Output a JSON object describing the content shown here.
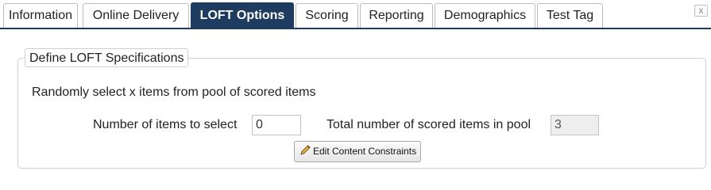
{
  "tabs": [
    {
      "label": "Information",
      "active": false
    },
    {
      "label": "Online Delivery",
      "active": false
    },
    {
      "label": "LOFT Options",
      "active": true
    },
    {
      "label": "Scoring",
      "active": false
    },
    {
      "label": "Reporting",
      "active": false
    },
    {
      "label": "Demographics",
      "active": false
    },
    {
      "label": "Test Tag",
      "active": false
    }
  ],
  "close_icon": "close-icon",
  "close_glyph": "x",
  "loft": {
    "legend": "Define LOFT Specifications",
    "description": "Randomly select x items from pool of scored items",
    "count_label": "Number of items to select",
    "count_value": "0",
    "total_label": "Total number of scored items in pool",
    "total_value": "3",
    "edit_button_label": "Edit Content Constraints",
    "edit_button_icon": "pencil-icon"
  },
  "colors": {
    "active_tab": "#1e3c5f",
    "active_tab_text": "#ffffff",
    "readonly_field": "#eeeeee"
  }
}
